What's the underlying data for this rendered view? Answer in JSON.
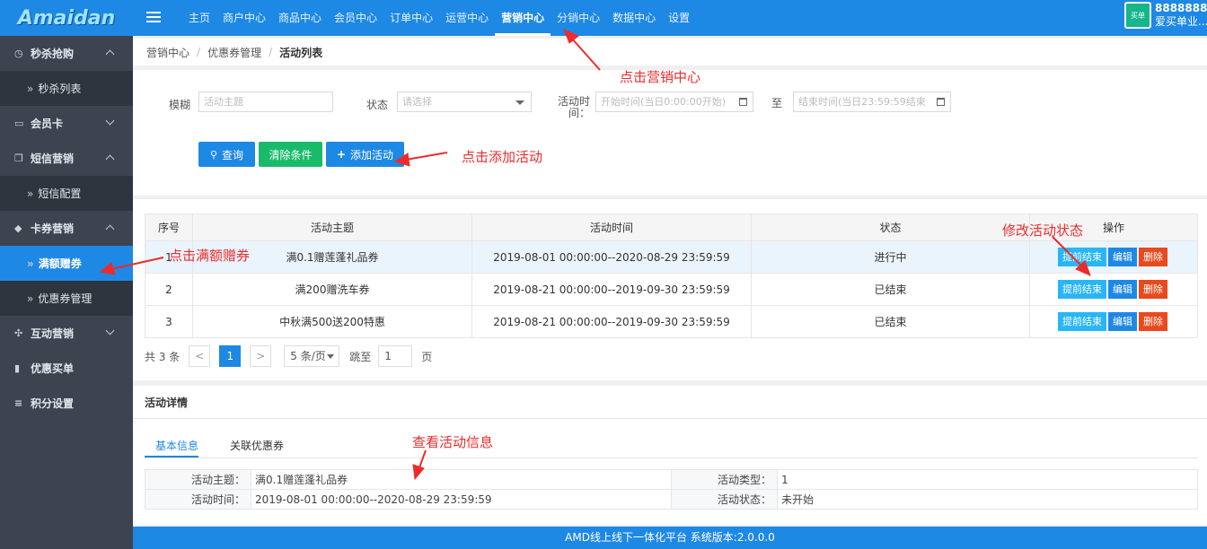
{
  "header": {
    "logo": "Amaidan",
    "nav": [
      "主页",
      "商户中心",
      "商品中心",
      "会员中心",
      "订单中心",
      "运营中心",
      "营销中心",
      "分销中心",
      "数据中心",
      "设置"
    ],
    "active_nav_index": 6,
    "user_badge": "买单",
    "user_id": "88888888",
    "user_name": "爱买单业..."
  },
  "sidebar": {
    "items": [
      {
        "icon": "clock-icon",
        "label": "秒杀抢购",
        "type": "group",
        "chevron": "up"
      },
      {
        "label": "秒杀列表",
        "type": "sub"
      },
      {
        "icon": "card-icon",
        "label": "会员卡",
        "type": "group",
        "chevron": "down"
      },
      {
        "icon": "message-icon",
        "label": "短信营销",
        "type": "group",
        "chevron": "up"
      },
      {
        "label": "短信配置",
        "type": "sub"
      },
      {
        "icon": "tag-icon",
        "label": "卡券营销",
        "type": "group",
        "chevron": "up"
      },
      {
        "label": "满额赠券",
        "type": "sub",
        "active": true
      },
      {
        "label": "优惠券管理",
        "type": "sub"
      },
      {
        "icon": "puzzle-icon",
        "label": "互动营销",
        "type": "group",
        "chevron": "down"
      },
      {
        "icon": "briefcase-icon",
        "label": "优惠买单",
        "type": "group"
      },
      {
        "icon": "database-icon",
        "label": "积分设置",
        "type": "group"
      }
    ]
  },
  "breadcrumb": [
    "营销中心",
    "优惠券管理",
    "活动列表"
  ],
  "filter": {
    "fuzzy_label": "模糊",
    "fuzzy_placeholder": "活动主题",
    "status_label": "状态",
    "status_placeholder": "请选择",
    "time_label": "活动时间：",
    "start_placeholder": "开始时间(当日0:00:00开始)",
    "to_label": "至",
    "end_placeholder": "结束时间(当日23:59:59结束",
    "query_btn": "查询",
    "clear_btn": "清除条件",
    "add_btn": "添加活动"
  },
  "table": {
    "headers": [
      "序号",
      "活动主题",
      "活动时间",
      "状态",
      "操作"
    ],
    "rows": [
      {
        "no": "1",
        "title": "满0.1赠莲蓬礼品券",
        "time": "2019-08-01 00:00:00--2020-08-29 23:59:59",
        "status": "进行中"
      },
      {
        "no": "2",
        "title": "满200赠洗车券",
        "time": "2019-08-21 00:00:00--2019-09-30 23:59:59",
        "status": "已结束"
      },
      {
        "no": "3",
        "title": "中秋满500送200特惠",
        "time": "2019-08-21 00:00:00--2019-09-30 23:59:59",
        "status": "已结束"
      }
    ],
    "actions": [
      "提前结束",
      "编辑",
      "删除"
    ]
  },
  "pager": {
    "total": "共 3 条",
    "prev": "<",
    "page": "1",
    "next": ">",
    "size": "5 条/页",
    "jump_label": "跳至",
    "jump_value": "1",
    "page_unit": "页"
  },
  "detail": {
    "title": "活动详情",
    "tabs": [
      "基本信息",
      "关联优惠券"
    ],
    "k1": "活动主题：",
    "v1": "满0.1赠莲蓬礼品券",
    "k2": "活动类型：",
    "v2": "1",
    "k3": "活动时间：",
    "v3": "2019-08-01 00:00:00--2020-08-29 23:59:59",
    "k4": "活动状态：",
    "v4": "未开始"
  },
  "annotations": {
    "a1": "点击营销中心",
    "a2": "点击添加活动",
    "a3": "点击满额赠券",
    "a4": "修改活动状态",
    "a5": "查看活动信息"
  },
  "colors": {
    "primary": "#1e88e5",
    "success": "#1aba6b",
    "info": "#29b6f6",
    "danger": "#e8491d",
    "annotation": "#ee2b2b",
    "sidebar": "#3d4450"
  },
  "footer": "AMD线上线下一体化平台 系统版本:2.0.0.0"
}
